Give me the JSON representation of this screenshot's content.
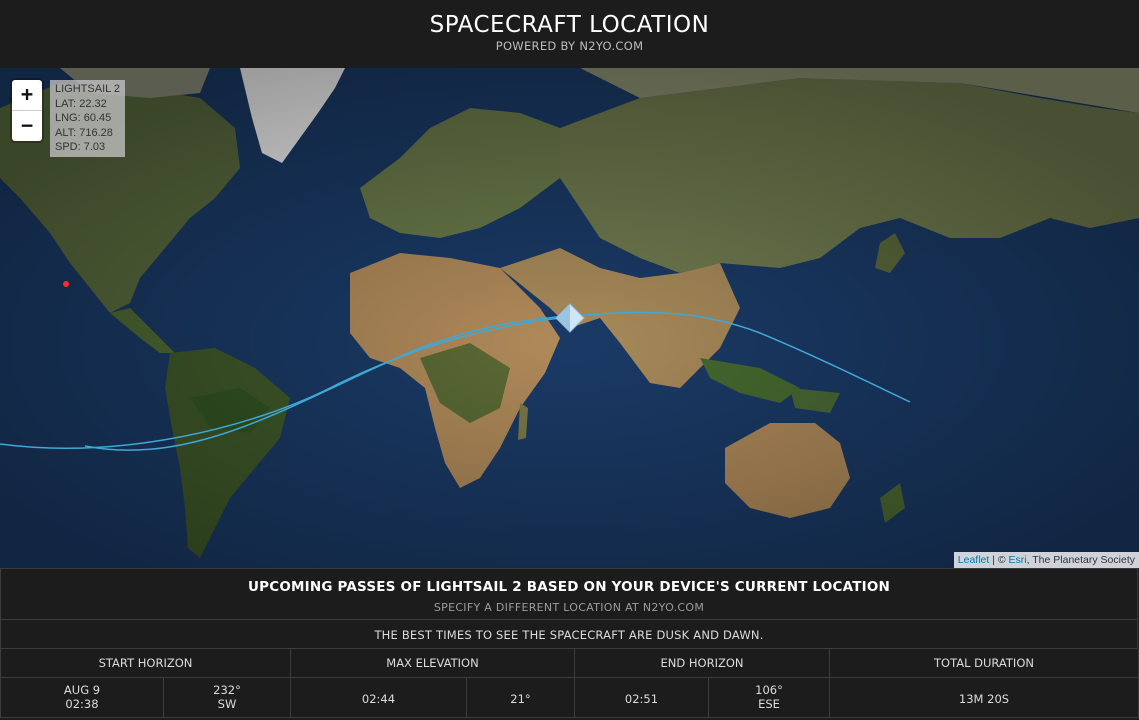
{
  "header": {
    "title": "SPACECRAFT LOCATION",
    "subtitle": "POWERED BY N2YO.COM"
  },
  "map": {
    "zoom_in_label": "+",
    "zoom_out_label": "−",
    "info": {
      "name": "LIGHTSAIL 2",
      "lat": "LAT: 22.32",
      "lng": "LNG: 60.45",
      "alt": "ALT: 716.28",
      "spd": "SPD: 7.03"
    },
    "attribution": {
      "leaflet": "Leaflet",
      "sep": " | © ",
      "esri": "Esri",
      "rest": ", The Planetary Society"
    },
    "colors": {
      "ocean": "#17345e",
      "track": "#3fa8d6",
      "observer": "#ff2a2a"
    }
  },
  "passes": {
    "heading": "UPCOMING PASSES OF LIGHTSAIL 2 BASED ON YOUR DEVICE'S CURRENT LOCATION",
    "subheading": "SPECIFY A DIFFERENT LOCATION AT N2YO.COM",
    "tip": "THE BEST TIMES TO SEE THE SPACECRAFT ARE DUSK AND DAWN.",
    "columns": [
      "START HORIZON",
      "MAX ELEVATION",
      "END HORIZON",
      "TOTAL DURATION"
    ],
    "row": {
      "start_date": "AUG 9",
      "start_time": "02:38",
      "start_az": "232°",
      "start_dir": "SW",
      "max_time": "02:44",
      "max_elev": "21°",
      "end_time": "02:51",
      "end_az": "106°",
      "end_dir": "ESE",
      "duration": "13M 20S"
    }
  }
}
